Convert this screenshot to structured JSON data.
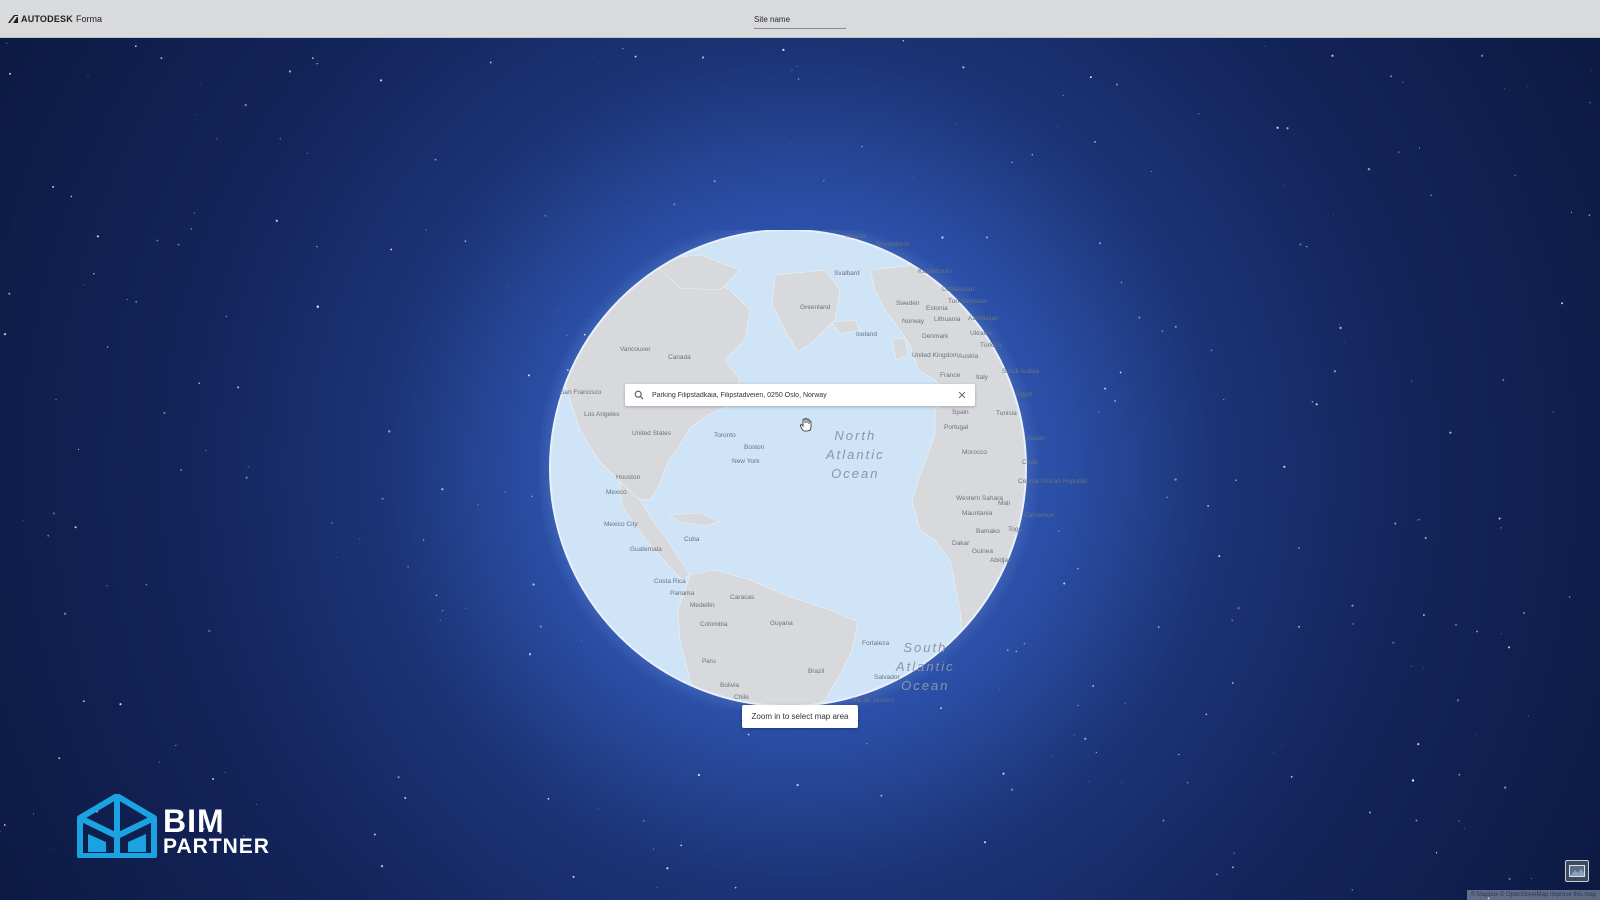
{
  "header": {
    "brand_name": "AUTODESK",
    "product_name": "Forma",
    "site_name_value": "Site name"
  },
  "search": {
    "value": "Parking Filipstadkaia, Filipstadveien, 0250 Oslo, Norway"
  },
  "map": {
    "labels": [
      "Russia",
      "Novosibirsk",
      "Svalbard",
      "Kazakhstan",
      "Uzbekistan",
      "Turkmenistan",
      "Azerbaijan",
      "Sweden",
      "Estonia",
      "Lithuania",
      "Greenland",
      "Iceland",
      "Norway",
      "Denmark",
      "Ukraine",
      "Austria",
      "Türkiye",
      "United Kingdom",
      "Italy",
      "France",
      "Saudi Arabia",
      "Vancouver",
      "Canada",
      "San Francisco",
      "Los Angeles",
      "Spain",
      "Egypt",
      "Portugal",
      "Tunisia",
      "Sudan",
      "United States",
      "Toronto",
      "Boston",
      "New York",
      "Chad",
      "Morocco",
      "Houston",
      "Central African Republic",
      "Western Sahara",
      "Mali",
      "Mexico",
      "Mauritania",
      "Cameroon",
      "Mexico City",
      "Cuba",
      "Bamako",
      "Togo",
      "Dakar",
      "Guinea",
      "Guatemala",
      "Abidjan",
      "Costa Rica",
      "Panama",
      "Caracas",
      "Medellín",
      "Guyana",
      "Colombia",
      "Fortaleza",
      "Peru",
      "Brazil",
      "Salvador",
      "Bolivia",
      "Rio de Janeiro",
      "Chile"
    ],
    "ocean_north": "North\nAtlantic\nOcean",
    "ocean_south": "South\nAtlantic\nOcean",
    "zoom_tip": "Zoom in to select map area",
    "attribution": "© Mapbox © OpenStreetMap  Improve this map"
  },
  "branding": {
    "line1": "BIM",
    "line2": "PARTNER"
  },
  "colors": {
    "topbar": "#d9dadc",
    "space_center": "#3a66c4",
    "space_edge": "#0a1535",
    "ocean": "#cfe4f7",
    "land": "#d7d9dc",
    "logo_blue": "#1aa3e0"
  },
  "icons": {
    "search": "search-icon",
    "clear": "close-icon",
    "cursor": "hand-cursor-icon",
    "layers": "satellite-layer-icon",
    "brand": "autodesk-logo-icon"
  }
}
